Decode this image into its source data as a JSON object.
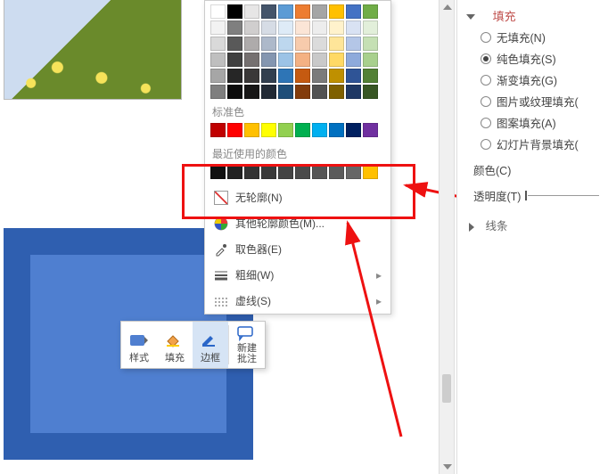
{
  "color_panel": {
    "theme_colors": [
      [
        "#ffffff",
        "#000000",
        "#e7e6e6",
        "#44546a",
        "#5b9bd5",
        "#ed7d31",
        "#a5a5a5",
        "#ffc000",
        "#4472c4",
        "#70ad47"
      ],
      [
        "#f2f2f2",
        "#7f7f7f",
        "#d0cece",
        "#d6dce5",
        "#deebf7",
        "#fbe5d6",
        "#ededed",
        "#fff2cc",
        "#d9e2f3",
        "#e2efda"
      ],
      [
        "#d9d9d9",
        "#595959",
        "#aeabab",
        "#adb9ca",
        "#bdd7ee",
        "#f7cbac",
        "#dbdbdb",
        "#fee599",
        "#b4c6e7",
        "#c5e0b4"
      ],
      [
        "#bfbfbf",
        "#3f3f3f",
        "#757070",
        "#8496b0",
        "#9cc3e6",
        "#f4b183",
        "#c9c9c9",
        "#ffd965",
        "#8eaadb",
        "#a8d08d"
      ],
      [
        "#a6a6a6",
        "#262626",
        "#3a3838",
        "#323f4f",
        "#2e75b6",
        "#c55a11",
        "#7b7b7b",
        "#bf9000",
        "#2f5496",
        "#538135"
      ],
      [
        "#7f7f7f",
        "#0c0c0c",
        "#171616",
        "#222a35",
        "#1f4e79",
        "#833c0c",
        "#525252",
        "#7f6000",
        "#1f3864",
        "#375623"
      ]
    ],
    "standard_label": "标准色",
    "standard_colors": [
      "#c00000",
      "#ff0000",
      "#ffc000",
      "#ffff00",
      "#92d050",
      "#00b050",
      "#00b0f0",
      "#0070c0",
      "#002060",
      "#7030a0"
    ],
    "recent_label": "最近使用的颜色",
    "recent_colors": [
      "#111111",
      "#222222",
      "#333333",
      "#3a3a3a",
      "#444444",
      "#4a4a4a",
      "#555555",
      "#5b5b5b",
      "#666666",
      "#ffc000"
    ],
    "no_outline": "无轮廓(N)",
    "more_colors": "其他轮廓颜色(M)...",
    "eyedropper": "取色器(E)",
    "weight": "粗细(W)",
    "dashes": "虚线(S)"
  },
  "mini_toolbar": {
    "style": "样式",
    "fill": "填充",
    "border": "边框",
    "comment": "新建\n批注"
  },
  "format_pane": {
    "fill_header": "填充",
    "no_fill": "无填充(N)",
    "solid_fill": "纯色填充(S)",
    "gradient_fill": "渐变填充(G)",
    "picture_fill": "图片或纹理填充(",
    "pattern_fill": "图案填充(A)",
    "slide_bg_fill": "幻灯片背景填充(",
    "color": "颜色(C)",
    "transparency": "透明度(T)",
    "line_header": "线条",
    "selected": "solid_fill"
  }
}
